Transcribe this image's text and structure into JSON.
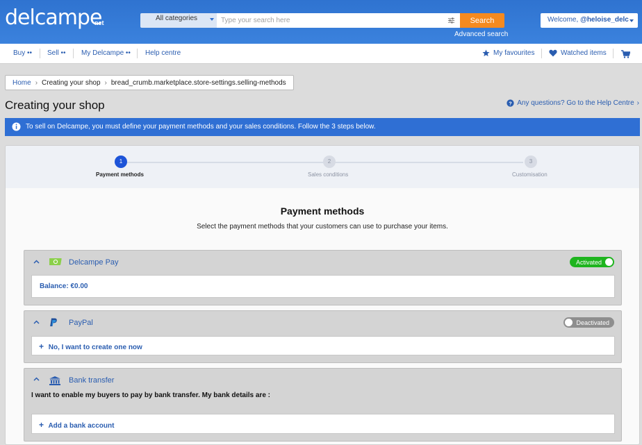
{
  "header": {
    "logo": "delcampe",
    "logo_suffix": "net",
    "category_select": "All categories",
    "search_placeholder": "Type your search here",
    "search_button": "Search",
    "advanced_search": "Advanced search",
    "welcome_prefix": "Welcome,",
    "welcome_user": "@heloise_delc"
  },
  "nav": {
    "buy": "Buy ••",
    "sell": "Sell ••",
    "my_delcampe": "My Delcampe ••",
    "help": "Help centre",
    "favourites": "My favourites",
    "watched": "Watched items"
  },
  "breadcrumb": {
    "home": "Home",
    "creating": "Creating your shop",
    "current": "bread_crumb.marketplace.store-settings.selling-methods"
  },
  "page": {
    "title": "Creating your shop",
    "help_link": "Any questions? Go to the Help Centre",
    "info": "To sell on Delcampe, you must define your payment methods and your sales conditions. Follow the 3 steps below."
  },
  "steps": [
    {
      "num": "1",
      "label": "Payment methods"
    },
    {
      "num": "2",
      "label": "Sales conditions"
    },
    {
      "num": "3",
      "label": "Customisation"
    }
  ],
  "payment": {
    "title": "Payment methods",
    "subtitle": "Select the payment methods that your customers can use to purchase your items.",
    "delcampe_pay": {
      "name": "Delcampe Pay",
      "status": "Activated",
      "balance": "Balance: €0.00"
    },
    "paypal": {
      "name": "PayPal",
      "status": "Deactivated",
      "create": "No, I want to create one now"
    },
    "bank": {
      "name": "Bank transfer",
      "text": "I want to enable my buyers to pay by bank transfer. My bank details are :",
      "add": "Add a bank account"
    }
  },
  "colors": {
    "brand_blue": "#2f73d0",
    "search_orange": "#f58a1f",
    "activated_green": "#1eb41e",
    "deactivated_grey": "#8e8e8e"
  }
}
